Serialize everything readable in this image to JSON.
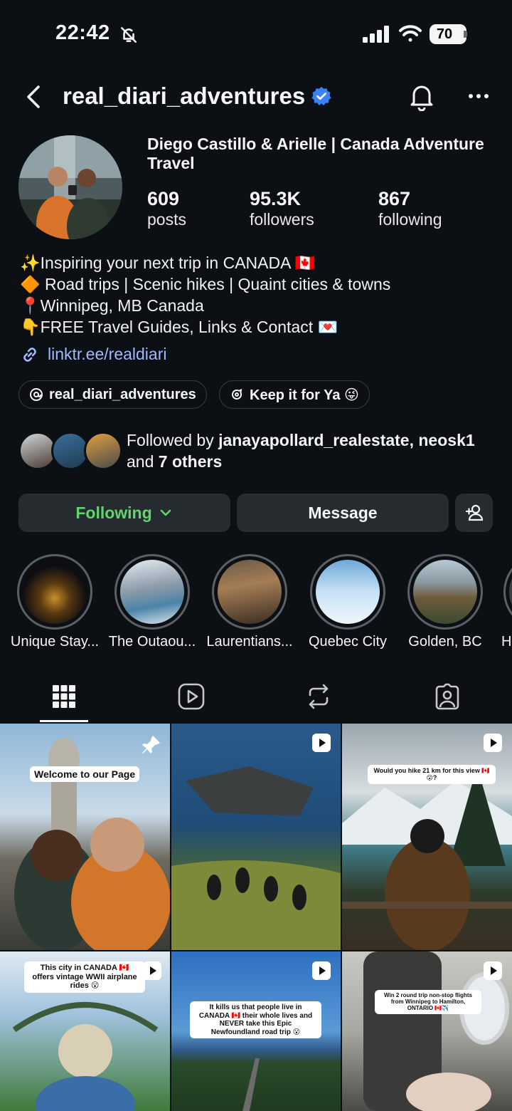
{
  "status_bar": {
    "time": "22:42",
    "battery": "70"
  },
  "header": {
    "username": "real_diari_adventures"
  },
  "profile": {
    "display_name": "Diego Castillo & Arielle | Canada Adventure Travel",
    "stats": [
      {
        "value": "609",
        "label": "posts"
      },
      {
        "value": "95.3K",
        "label": "followers"
      },
      {
        "value": "867",
        "label": "following"
      }
    ],
    "bio": [
      "✨Inspiring your next trip in CANADA 🇨🇦",
      "🔶 Road trips | Scenic hikes | Quaint cities & towns",
      "📍Winnipeg, MB Canada",
      "👇FREE Travel Guides, Links & Contact 💌"
    ],
    "link": "linktr.ee/realdiari",
    "chips": {
      "threads": "real_diari_adventures",
      "channel": "Keep it for Ya 😜"
    },
    "followed_by": {
      "prefix": "Followed by ",
      "names": "janayapollard_realestate, neosk1",
      "joiner": " and ",
      "others": "7 others"
    }
  },
  "actions": {
    "following": "Following",
    "message": "Message"
  },
  "highlights": [
    {
      "label": "Unique Stay..."
    },
    {
      "label": "The Outaou..."
    },
    {
      "label": "Laurentians..."
    },
    {
      "label": "Quebec City"
    },
    {
      "label": "Golden, BC"
    },
    {
      "label": "H"
    }
  ],
  "posts": [
    {
      "overlay": "Welcome to our Page"
    },
    {
      "overlay": ""
    },
    {
      "overlay": "Would you hike 21 km for this view 🇨🇦😮?"
    },
    {
      "overlay": "This city in CANADA 🇨🇦 offers vintage WWII airplane rides 😮"
    },
    {
      "overlay": "It kills us that people live in CANADA 🇨🇦 their whole lives and NEVER take this Epic Newfoundland road trip 😮"
    },
    {
      "overlay": "Win 2 round trip non-stop flights from Winnipeg to Hamilton, ONTARIO 🇨🇦✈️"
    }
  ],
  "colors": {
    "background": "#0c1014",
    "following_green": "#5fd66b",
    "link_blue": "#a0b8ff",
    "verified_blue": "#3b82f6"
  }
}
